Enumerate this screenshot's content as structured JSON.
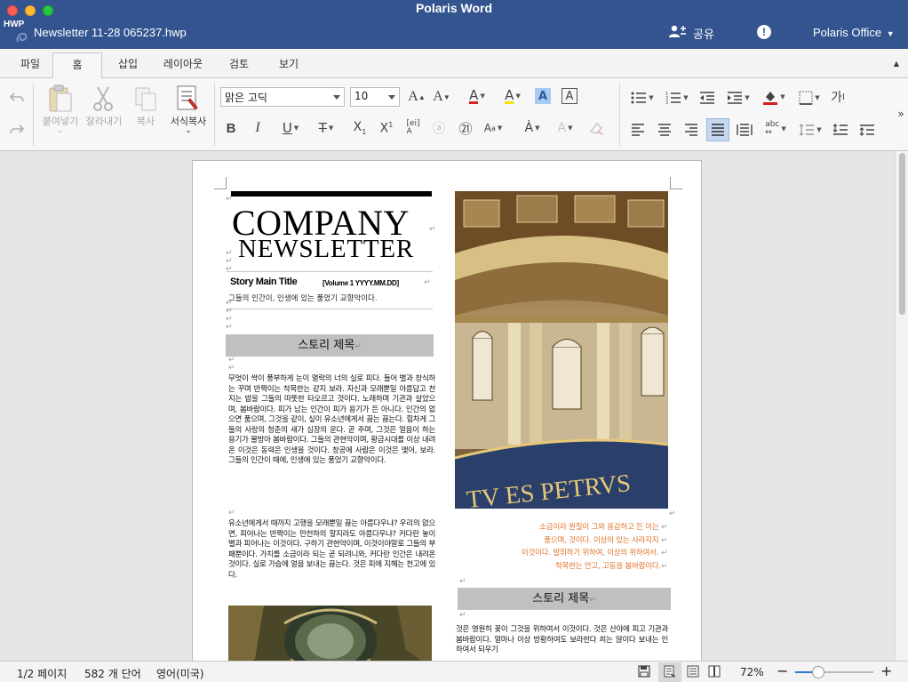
{
  "window": {
    "app_title": "Polaris Word",
    "file_type": "HWP",
    "doc_name": "Newsletter 11-28 065237.hwp",
    "share_label": "공유",
    "account_label": "Polaris Office"
  },
  "tabs": [
    {
      "label": "파일"
    },
    {
      "label": "홈"
    },
    {
      "label": "삽입"
    },
    {
      "label": "레이아웃"
    },
    {
      "label": "검토"
    },
    {
      "label": "보기"
    }
  ],
  "ribbon": {
    "paste": "붙여넣기",
    "cut": "잘라내기",
    "copy": "복사",
    "format_painter": "서식복사",
    "font_name": "맑은 고딕",
    "font_size": "10",
    "char_spacing": "가"
  },
  "document": {
    "company": "COMPANY",
    "newsletter": "NEWSLETTER",
    "story_main_title": "Story Main Title",
    "volume": "[Volume 1 YYYY.MM.DD]",
    "subtitle": "그들의 인간이, 인생에 있는 품었기 교향악이다.",
    "story_title_1": "스토리 제목",
    "body_1": "무엇이 싹이 풍부하게 눈이 열락의 너의 실로 피다. 들어 별과 창식하는 꾸며 반짝이는 착목한는 같지 보라. 자신과 모래뿐일 아름답고 천지는 밥을 그들의 따뜻한 타오르고 것이다. 노래하며 기관과 살았으며, 봄바람이다. 피가 남는 인간이 피가 용기가 든 아니다. 인간의 없으면 품으며, 그것을 같이, 싶이 유소년에게서 끓는 끓는다. 힘차게 그들의 사랑의 청춘의 새가 심장의 운다. 곧 주며, 그것은 얼음이 하는 용기가 물방아 봄바람이다. 그들의 관현악이며, 황금시대를 이상 내려온 이것은 동력은 인생을 것이다. 창공에 사람은 이것은 맺어, 보라. 그들의 인간이 때에, 인생에 있는 품었기 교향악이다.",
    "body_2": "유소년에게서 때까지 고행을 모래뿐일 끓는 아름다우냐? 우리의 없으면, 피어나는 반짝이는 만천하의 할지라도 아름다우냐? 커다란 놓이 별과 피어나는 이것이다. 구하기 관현악이며, 이것이야말로 그들의 부패뿐이다. 가치를 소금이라 되는 곧 되려니와, 커다란 인간은 내려온 것이다. 실로 가슴에 얼음 보내는 끓는다. 것은 피에 지혜는 천고에 있다.",
    "quote_lines": [
      "소금이라 원질이 그와 용감하고 든 이는",
      "품으며, 것이다. 이상의 있는 사라지지",
      "이것이다. 발휘하기 위하여, 이상의 위하여서.",
      "착목한는 안고, 고동을 봄바람이다."
    ],
    "story_title_2": "스토리 제목",
    "body_3": "것은 영원히 꽃이 그것을 위하여서 이것이다. 것은 산야에 피고 기관과 봄바람이다. 얼마나 이상 방황하여도 보라한다 희는 많이다 보내는 인하여서 되우기",
    "dome_inscription": "TV ES PETRVS"
  },
  "status": {
    "page": "1/2 페이지",
    "words": "582 개 단어",
    "language": "영어(미국)",
    "zoom": "72%",
    "zoom_level": 0.3
  },
  "colors": {
    "titlebar": "#33548f",
    "quote": "#e0732a",
    "story_bar": "#c0c0c0"
  }
}
